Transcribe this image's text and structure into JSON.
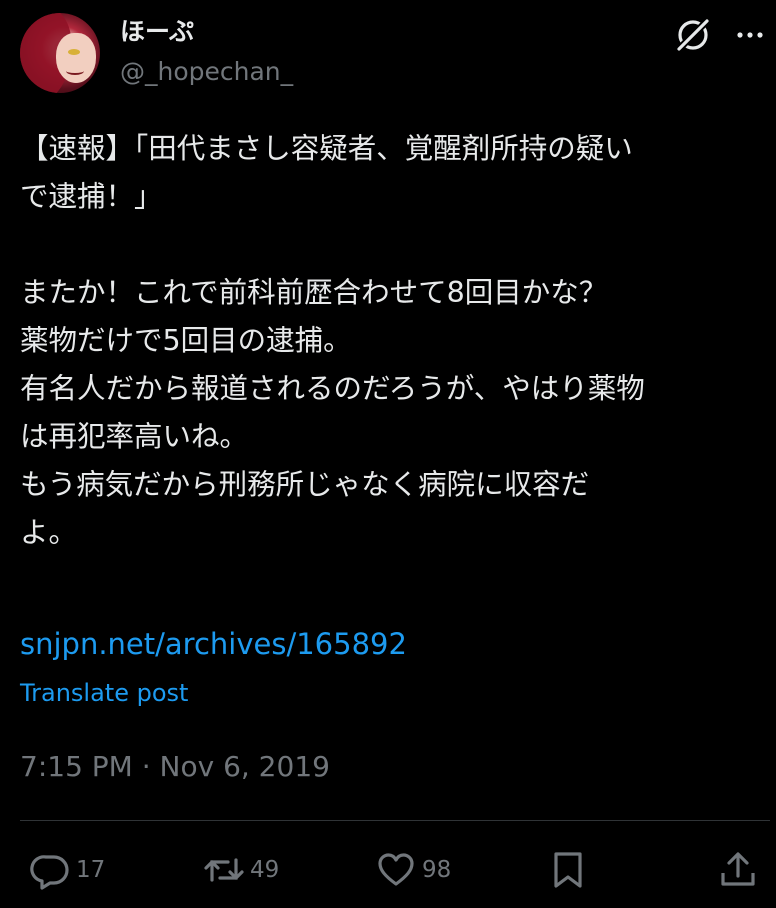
{
  "author": {
    "display_name": "ほーぷ",
    "handle": "@_hopechan_"
  },
  "header_icons": [
    "grok-icon",
    "more-icon"
  ],
  "tweet": {
    "text": "【速報】「田代まさし容疑者、覚醒剤所持の疑い\nで逮捕！」\n\nまたか！これで前科前歴合わせて8回目かな？\n薬物だけで5回目の逮捕。\n有名人だから報道されるのだろうが、やはり薬物\nは再犯率高いね。\nもう病気だから刑務所じゃなく病院に収容だ\nよ。",
    "link": "snjpn.net/archives/165892",
    "translate_label": "Translate post",
    "timestamp": "7:15 PM · Nov 6, 2019"
  },
  "actions": {
    "reply_count": "17",
    "retweet_count": "49",
    "like_count": "98",
    "icons": [
      "reply-icon",
      "retweet-icon",
      "like-icon",
      "bookmark-icon",
      "share-icon"
    ]
  },
  "colors": {
    "background": "#000000",
    "text": "#e7e9ea",
    "muted": "#71767b",
    "link": "#1d9bf0"
  }
}
